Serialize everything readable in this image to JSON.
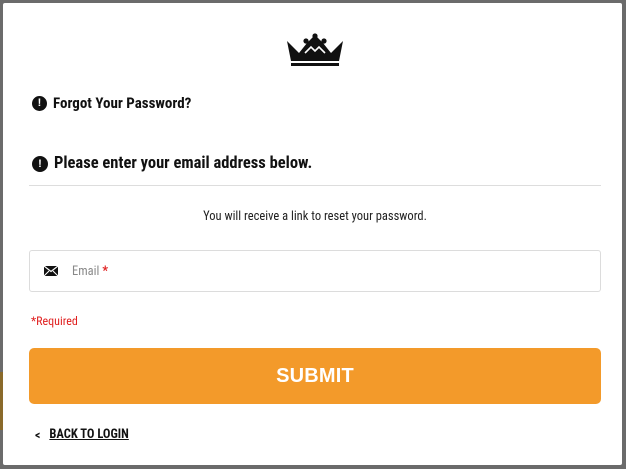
{
  "modal": {
    "heading": "Forgot Your Password?",
    "subheading": "Please enter your email address below.",
    "info_text": "You will receive a link to reset your password.",
    "alert_glyph": "!"
  },
  "form": {
    "email_placeholder": "Email",
    "required_marker": "*",
    "required_note": "*Required",
    "submit_label": "SUBMIT",
    "back_label": "BACK TO LOGIN",
    "back_chevron": "<"
  },
  "icons": {
    "logo": "crown-logo",
    "alert": "exclamation-circle-icon",
    "mail": "envelope-icon",
    "back": "chevron-left-icon"
  },
  "colors": {
    "accent": "#f39a2a",
    "required": "#e02020",
    "text": "#111111",
    "border": "#dcdcdc"
  }
}
